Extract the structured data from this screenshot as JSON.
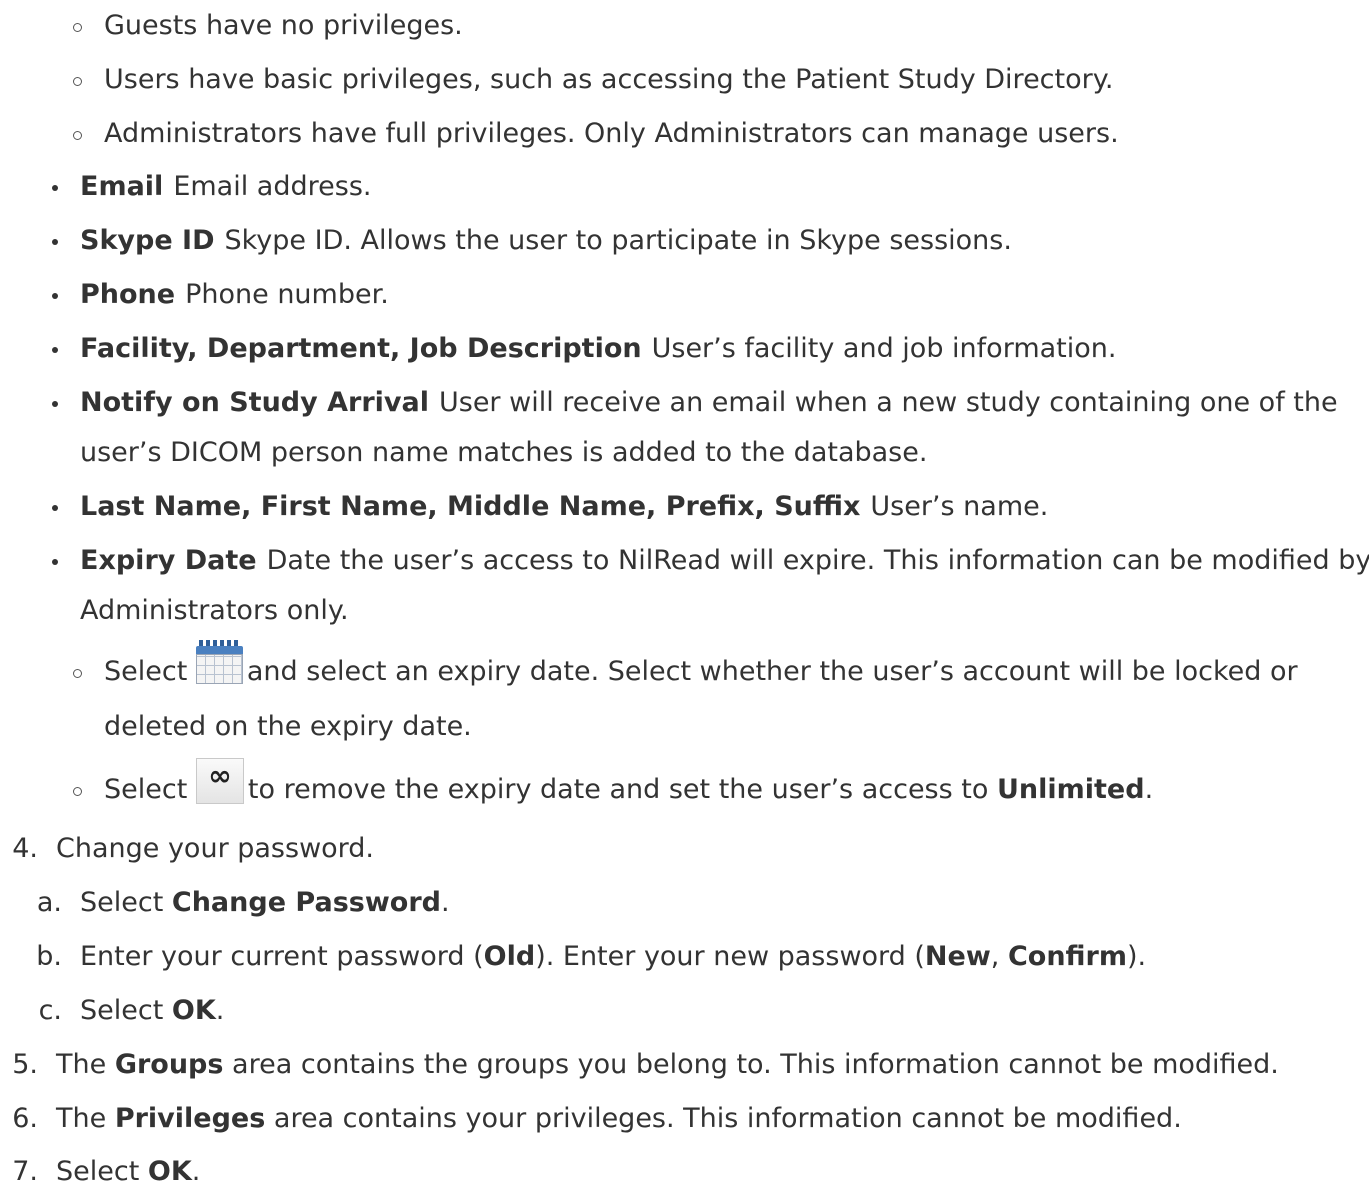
{
  "role_items": [
    {
      "text": "Guests have no privileges."
    },
    {
      "text": "Users have basic privileges, such as accessing the Patient Study Directory."
    },
    {
      "text": "Administrators have full privileges. Only Administrators can manage users."
    }
  ],
  "fields": [
    {
      "term": "Email",
      "desc": "Email address."
    },
    {
      "term": "Skype ID",
      "desc": "Skype ID. Allows the user to participate in Skype sessions."
    },
    {
      "term": "Phone",
      "desc": "Phone number."
    },
    {
      "term": "Facility, Department, Job Description",
      "desc": "User’s facility and job information."
    },
    {
      "term": "Notify on Study Arrival",
      "desc": "User will receive an email when a new study containing one of the",
      "desc2": "user’s DICOM person name matches is added to the database."
    },
    {
      "term": "Last Name, First Name, Middle Name, Prefix, Suffix",
      "desc": "User’s name."
    },
    {
      "term": "Expiry Date",
      "desc": "Date the user’s access to NilRead will expire. This information can be modified by",
      "desc2": "Administrators only."
    }
  ],
  "expiry_sub": {
    "calendar": {
      "pre": "Select",
      "icon": "calendar-icon",
      "post": "and select an expiry date. Select whether the user’s account will be locked or",
      "post2": "deleted on the expiry date."
    },
    "unlimited": {
      "pre": "Select",
      "icon": "infinity-icon",
      "icon_glyph": "∞",
      "post": "to remove the expiry date and set the user’s access to",
      "bold": "Unlimited",
      "end": "."
    }
  },
  "step4": {
    "number": "4.",
    "text": "Change your password.",
    "substeps": [
      {
        "marker": "a.",
        "pre": "Select ",
        "bold": "Change Password",
        "post": "."
      },
      {
        "marker": "b.",
        "pre": "Enter your current password (",
        "bold": "Old",
        "mid": "). Enter your new password (",
        "bold2": "New",
        "mid2": ", ",
        "bold3": "Confirm",
        "post": ")."
      },
      {
        "marker": "c.",
        "pre": "Select ",
        "bold": "OK",
        "post": "."
      }
    ]
  },
  "step5": {
    "number": "5.",
    "pre": "The ",
    "bold": "Groups",
    "post": " area contains the groups you belong to. This information cannot be modified."
  },
  "step6": {
    "number": "6.",
    "pre": "The ",
    "bold": "Privileges",
    "post": " area contains your privileges. This information cannot be modified."
  },
  "step7": {
    "number": "7.",
    "pre": "Select ",
    "bold": "OK",
    "post": "."
  }
}
